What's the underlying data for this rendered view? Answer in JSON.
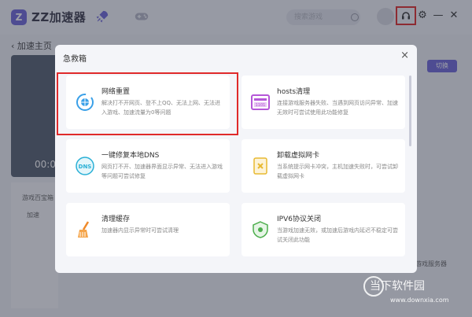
{
  "app": {
    "logo_text": "ZZ加速器",
    "logo_mark": "Z"
  },
  "search": {
    "placeholder": "搜索游戏"
  },
  "background": {
    "breadcrumb": "加速主页",
    "timer": "00:0",
    "side_title": "游戏百宝箱",
    "side_item": "加速",
    "switch_label": "切换",
    "server_label": "游戏服务器"
  },
  "modal": {
    "title": "急救箱",
    "close": "×",
    "cards": [
      {
        "title": "网络重置",
        "desc": "解决打不开网页、登不上QQ、无法上网、无法进入游戏、加速流量为0等问题"
      },
      {
        "title": "hosts清理",
        "desc": "连接游戏服务器失败、当遇到网页访问异常、加速无效时可尝试使用此功能修复"
      },
      {
        "title": "一键修复本地DNS",
        "desc": "网页打不开、加速器界面显示异常、无法进入游戏等问题可尝试修复"
      },
      {
        "title": "卸载虚拟网卡",
        "desc": "当系统提示网卡冲突，主机加速失败时，可尝试卸载虚拟网卡"
      },
      {
        "title": "清理缓存",
        "desc": "加速器内显示异常时可尝试清理"
      },
      {
        "title": "IPV6协议关闭",
        "desc": "当游戏加速无效，或加速后游戏内延迟不稳定可尝试关闭此功能"
      }
    ]
  },
  "watermark": {
    "text": "当下软件园",
    "url": "www.downxia.com"
  },
  "icons": {
    "network_reset": "globe-refresh-icon",
    "hosts": "hosts-file-icon",
    "dns": "dns-icon",
    "virtual_nic": "uninstall-nic-icon",
    "cache": "broom-icon",
    "ipv6": "shield-icon"
  },
  "colors": {
    "accent": "#6d66d9",
    "highlight": "#e02a2a"
  }
}
